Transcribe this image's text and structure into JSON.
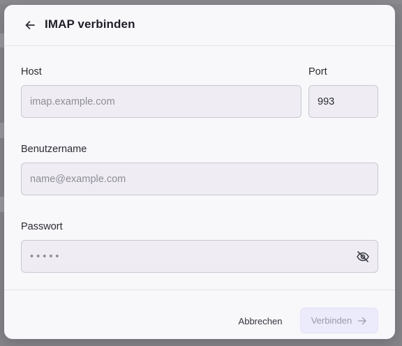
{
  "dialog": {
    "title": "IMAP verbinden",
    "back_icon": "arrow-left-icon"
  },
  "form": {
    "host": {
      "label": "Host",
      "placeholder": "imap.example.com",
      "value": ""
    },
    "port": {
      "label": "Port",
      "value": "993"
    },
    "username": {
      "label": "Benutzername",
      "placeholder": "name@example.com",
      "value": ""
    },
    "password": {
      "label": "Passwort",
      "placeholder": "• • • • •",
      "value": "",
      "visibility_icon": "eye-off-icon"
    }
  },
  "footer": {
    "cancel_label": "Abbrechen",
    "connect_label": "Verbinden",
    "connect_icon": "arrow-right-icon",
    "connect_disabled": true
  },
  "colors": {
    "accent_disabled_bg": "#ecebfb",
    "input_bg": "#efedf3",
    "dialog_bg": "#f8f8fa"
  }
}
